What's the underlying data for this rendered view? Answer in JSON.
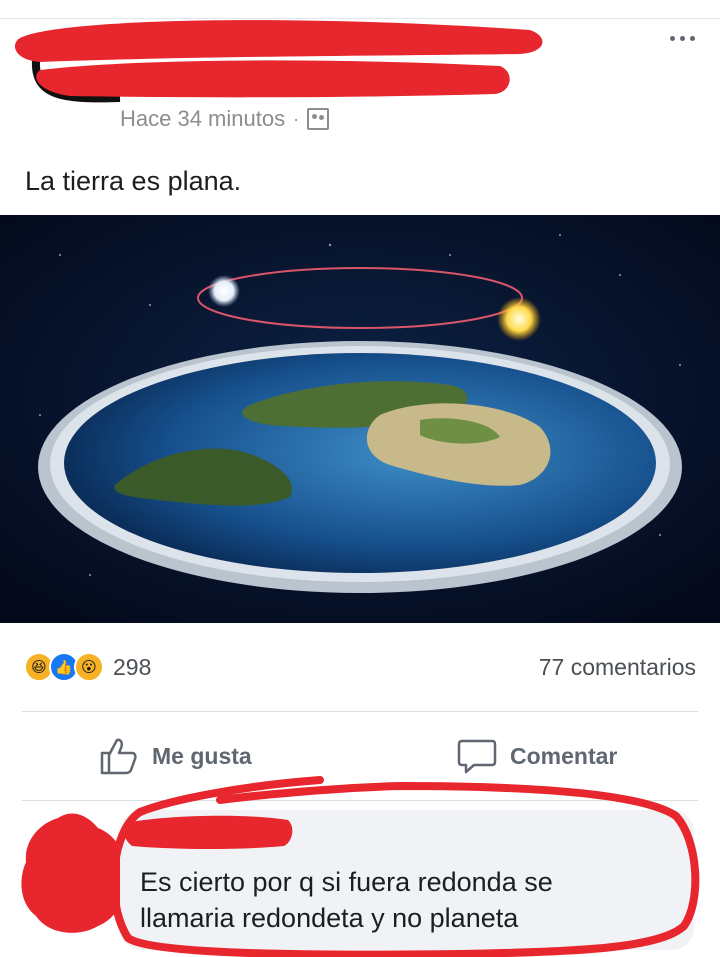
{
  "post": {
    "timestamp": "Hace 34 minutos",
    "separator": "·",
    "privacy_icon": "friends-icon",
    "text": "La tierra es plana."
  },
  "stats": {
    "reaction_icons": [
      "haha-reaction-icon",
      "like-reaction-icon",
      "wow-reaction-icon"
    ],
    "reaction_count": "298",
    "comments": "77 comentarios"
  },
  "actions": {
    "like_label": "Me gusta",
    "comment_label": "Comentar"
  },
  "comment": {
    "line1": "Es cierto por q si fuera redonda se",
    "line2": "llamaria redondeta y no planeta"
  },
  "colors": {
    "redaction": "#e8262d",
    "like_blue": "#1877f2",
    "space": "#061226"
  }
}
